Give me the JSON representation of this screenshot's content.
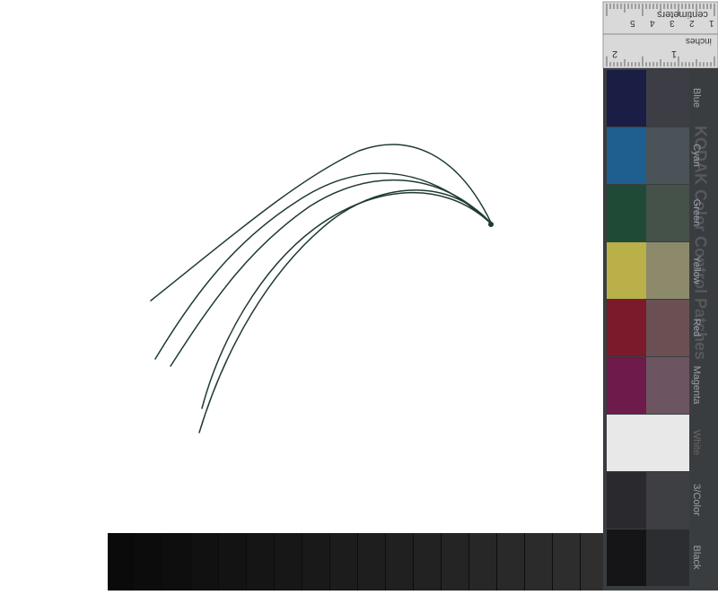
{
  "colors": {
    "background": "#ffffff",
    "strands": "#1f3a34",
    "ruler": "#d9d9d9",
    "strip_dark": "#0d0d0d",
    "kodak_panel": "#3a3d40"
  },
  "ruler": {
    "unit_top": "centimeters",
    "unit_bottom": "inches",
    "cm_marks": [
      "1",
      "2",
      "3",
      "4",
      "5"
    ],
    "inch_marks": [
      "1",
      "2"
    ]
  },
  "kodak": {
    "title": "KODAK Color Control Patches",
    "patches": [
      {
        "label": "Blue",
        "swatch": "#1b1e44",
        "tone": "#3d3d45"
      },
      {
        "label": "Cyan",
        "swatch": "#1e5f8f",
        "tone": "#4a5358"
      },
      {
        "label": "Green",
        "swatch": "#1f4b36",
        "tone": "#44524a"
      },
      {
        "label": "Yellow",
        "swatch": "#b9b04a",
        "tone": "#8c8a6a"
      },
      {
        "label": "Red",
        "swatch": "#7a1a2a",
        "tone": "#6a5052"
      },
      {
        "label": "Magenta",
        "swatch": "#6e1a4a",
        "tone": "#6c5560"
      },
      {
        "label": "White",
        "swatch": "#e8e8e8",
        "tone": "#e8e8e8"
      },
      {
        "label": "3/Color",
        "swatch": "#2a2a2e",
        "tone": "#3e3f42"
      },
      {
        "label": "Black",
        "swatch": "#151517",
        "tone": "#2c2d30"
      }
    ]
  },
  "specimen": {
    "description_icon": "hair-strands-icon"
  }
}
